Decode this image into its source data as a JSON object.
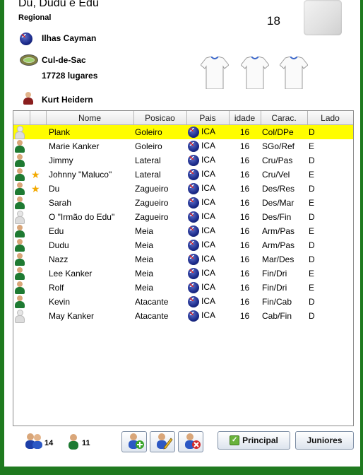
{
  "header": {
    "team_name": "Du, Dudu e Edu",
    "level": "Regional",
    "number": "18",
    "country": "Ilhas Cayman",
    "stadium": "Cul-de-Sac",
    "capacity": "17728 lugares",
    "coach": "Kurt Heidern"
  },
  "table": {
    "columns": [
      "",
      "",
      "Nome",
      "Posicao",
      "Pais",
      "idade",
      "Carac.",
      "Lado"
    ],
    "rows": [
      {
        "icon": "player-gray-icon",
        "star": false,
        "name": "Plank",
        "pos": "Goleiro",
        "pais": "ICA",
        "age": "16",
        "carac": "Col/DPe",
        "lado": "D",
        "selected": true
      },
      {
        "icon": "player-green-icon",
        "star": false,
        "name": "Marie Kanker",
        "pos": "Goleiro",
        "pais": "ICA",
        "age": "16",
        "carac": "SGo/Ref",
        "lado": "E",
        "selected": false
      },
      {
        "icon": "player-green-icon",
        "star": false,
        "name": "Jimmy",
        "pos": "Lateral",
        "pais": "ICA",
        "age": "16",
        "carac": "Cru/Pas",
        "lado": "D",
        "selected": false
      },
      {
        "icon": "player-green-icon",
        "star": true,
        "name": "Johnny \"Maluco\"",
        "pos": "Lateral",
        "pais": "ICA",
        "age": "16",
        "carac": "Cru/Vel",
        "lado": "E",
        "selected": false
      },
      {
        "icon": "player-green-icon",
        "star": true,
        "name": "Du",
        "pos": "Zagueiro",
        "pais": "ICA",
        "age": "16",
        "carac": "Des/Res",
        "lado": "D",
        "selected": false
      },
      {
        "icon": "player-green-icon",
        "star": false,
        "name": "Sarah",
        "pos": "Zagueiro",
        "pais": "ICA",
        "age": "16",
        "carac": "Des/Mar",
        "lado": "E",
        "selected": false
      },
      {
        "icon": "player-gray-icon",
        "star": false,
        "name": "O \"Irmão do Edu\"",
        "pos": "Zagueiro",
        "pais": "ICA",
        "age": "16",
        "carac": "Des/Fin",
        "lado": "D",
        "selected": false
      },
      {
        "icon": "player-green-icon",
        "star": false,
        "name": "Edu",
        "pos": "Meia",
        "pais": "ICA",
        "age": "16",
        "carac": "Arm/Pas",
        "lado": "E",
        "selected": false
      },
      {
        "icon": "player-green-icon",
        "star": false,
        "name": "Dudu",
        "pos": "Meia",
        "pais": "ICA",
        "age": "16",
        "carac": "Arm/Pas",
        "lado": "D",
        "selected": false
      },
      {
        "icon": "player-green-icon",
        "star": false,
        "name": "Nazz",
        "pos": "Meia",
        "pais": "ICA",
        "age": "16",
        "carac": "Mar/Des",
        "lado": "D",
        "selected": false
      },
      {
        "icon": "player-green-icon",
        "star": false,
        "name": "Lee Kanker",
        "pos": "Meia",
        "pais": "ICA",
        "age": "16",
        "carac": "Fin/Dri",
        "lado": "E",
        "selected": false
      },
      {
        "icon": "player-green-icon",
        "star": false,
        "name": "Rolf",
        "pos": "Meia",
        "pais": "ICA",
        "age": "16",
        "carac": "Fin/Dri",
        "lado": "E",
        "selected": false
      },
      {
        "icon": "player-green-icon",
        "star": false,
        "name": "Kevin",
        "pos": "Atacante",
        "pais": "ICA",
        "age": "16",
        "carac": "Fin/Cab",
        "lado": "D",
        "selected": false
      },
      {
        "icon": "player-gray-icon",
        "star": false,
        "name": "May Kanker",
        "pos": "Atacante",
        "pais": "ICA",
        "age": "16",
        "carac": "Cab/Fin",
        "lado": "D",
        "selected": false
      }
    ]
  },
  "footer": {
    "total_players": "14",
    "active_players": "11",
    "principal_label": "Principal",
    "juniores_label": "Juniores"
  },
  "colors": {
    "window_border": "#1f7a1f",
    "selection": "#fffd00",
    "player_icon": "#1e7a32",
    "star": "#f2a900"
  }
}
